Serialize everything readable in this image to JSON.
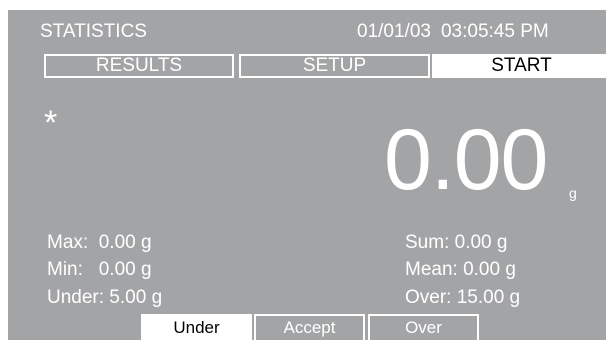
{
  "header": {
    "title": "STATISTICS",
    "date": "01/01/03",
    "time": "03:05:45 PM"
  },
  "tabs": [
    {
      "label": "RESULTS",
      "active": false
    },
    {
      "label": "SETUP",
      "active": false
    },
    {
      "label": "START",
      "active": true
    }
  ],
  "indicator": "*",
  "reading": {
    "value": "0.00",
    "unit": "g"
  },
  "stats": {
    "max": "Max:  0.00 g",
    "min": "Min:   0.00 g",
    "under": "Under: 5.00 g",
    "sum": "Sum: 0.00 g",
    "mean": "Mean: 0.00 g",
    "over": "Over: 15.00 g"
  },
  "bottom_tabs": [
    {
      "label": "Under",
      "active": true
    },
    {
      "label": "Accept",
      "active": false
    },
    {
      "label": "Over",
      "active": false
    }
  ],
  "colors": {
    "screen_background": "#a3a4a6",
    "text": "#ffffff",
    "active_tab_background": "#ffffff",
    "active_tab_text": "#000000"
  }
}
